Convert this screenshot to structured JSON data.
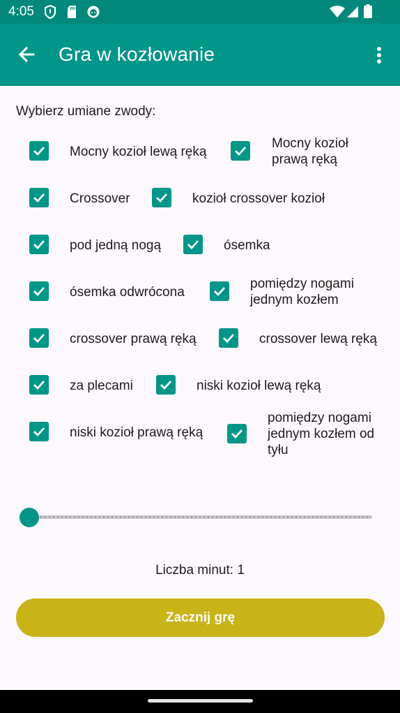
{
  "status_bar": {
    "time": "4:05",
    "left_icons": [
      "shield-icon",
      "sd-card-icon",
      "notification-face-icon"
    ],
    "right_icons": [
      "wifi-icon",
      "signal-icon",
      "battery-icon"
    ]
  },
  "app_bar": {
    "title": "Gra w kozłowanie",
    "back_icon": "arrow-left-icon",
    "menu_icon": "more-vert-icon",
    "color": "#009688"
  },
  "prompt": "Wybierz umiane zwody:",
  "options": [
    {
      "label": "Mocny kozioł lewą ręką",
      "checked": true
    },
    {
      "label": "Mocny kozioł prawą ręką",
      "checked": true
    },
    {
      "label": "Crossover",
      "checked": true
    },
    {
      "label": "kozioł crossover kozioł",
      "checked": true
    },
    {
      "label": "pod jedną nogą",
      "checked": true
    },
    {
      "label": "ósemka",
      "checked": true
    },
    {
      "label": "ósemka odwrócona",
      "checked": true
    },
    {
      "label": "pomiędzy nogami jednym kozłem",
      "checked": true
    },
    {
      "label": "crossover prawą ręką",
      "checked": true
    },
    {
      "label": "crossover lewą ręką",
      "checked": true
    },
    {
      "label": "za plecami",
      "checked": true
    },
    {
      "label": "niski kozioł lewą ręką",
      "checked": true
    },
    {
      "label": "niski kozioł prawą ręką",
      "checked": true
    },
    {
      "label": "pomiędzy nogami jednym kozłem od tyłu",
      "checked": true
    }
  ],
  "slider": {
    "value": 1,
    "min": 1,
    "max": 60
  },
  "minutes_text": "Liczba minut: 1",
  "start_button": {
    "label": "Zacznij grę",
    "color": "#c8b416"
  },
  "colors": {
    "accent": "#009688",
    "status_bar": "#00897b",
    "background": "#fdf8fd"
  }
}
